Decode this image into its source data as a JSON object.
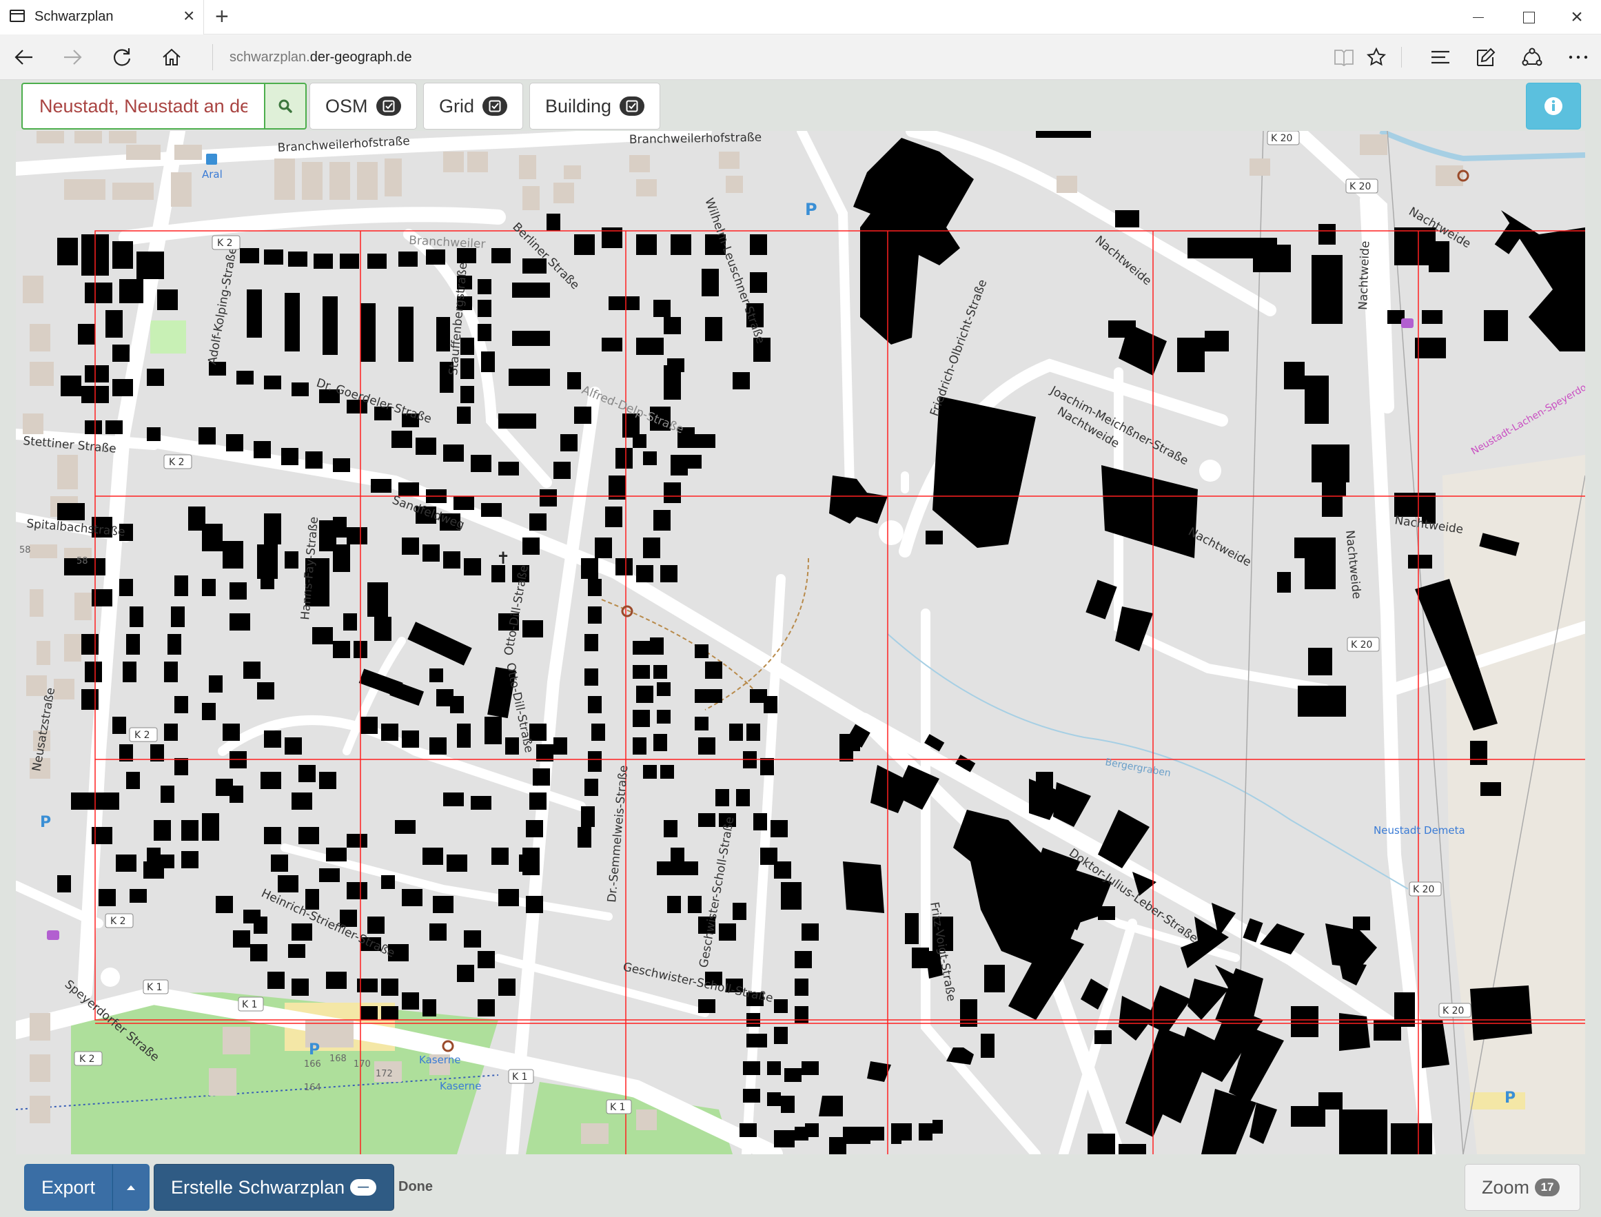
{
  "browser": {
    "tab_title": "Schwarzplan",
    "url_prefix": "schwarzplan.",
    "url_host": "der-geograph.de"
  },
  "toolbar": {
    "search_value": "Neustadt, Neustadt an der Weinstraße",
    "search_icon": "search-icon",
    "layers": [
      {
        "label": "OSM",
        "checked": true
      },
      {
        "label": "Grid",
        "checked": true
      },
      {
        "label": "Building",
        "checked": true
      }
    ],
    "info_icon": "info-circle-icon"
  },
  "map": {
    "street_labels": [
      "Branchweilerhofstraße",
      "Branchweilerhofstraße",
      "Branchweiler",
      "Berliner Straße",
      "Wilhelm-Leuschner-Straße",
      "Adolf-Kolping-Straße",
      "Stauffenbergstraße",
      "Dr. Goerdeler-Straße",
      "Alfred-Delp-Straße",
      "Stettiner Straße",
      "Sandfeldweg",
      "Spitalbachstraße",
      "Hanns-Fay-Straße",
      "Otto-Dill-Straße",
      "Otto-Dill-Straße",
      "Dr.-Semmelweis-Straße",
      "Heinrich-Strieffler-Straße",
      "Speyerdorfer Straße",
      "Neusatzstraße",
      "Geschwister-Scholl-Straße",
      "Geschwister-Scholl-Straße",
      "Friedrich-Olbricht-Straße",
      "Joachim-Meichßner-Straße",
      "Nachtweide",
      "Nachtweide",
      "Nachtweide",
      "Nachtweide",
      "Doktor-Julius-Leber-Straße",
      "Fritz-Voigt-Straße",
      "Nachtweide",
      "Nachtweide",
      "Neustadt-Lachen-Speyerdorf",
      "Spitalbachstraße"
    ],
    "road_refs": [
      "K 2",
      "K 20",
      "K 1"
    ],
    "poi_labels": [
      "Aral",
      "Kaserne",
      "Kaserne",
      "Neustadt Demeta"
    ],
    "house_numbers": [
      "166",
      "168",
      "170",
      "172",
      "164",
      "58",
      "58"
    ],
    "stream_label": "Bergergraben"
  },
  "bottom": {
    "export_label": "Export",
    "generate_label": "Erstelle Schwarzplan",
    "status": "Done",
    "zoom_label": "Zoom",
    "zoom_level": "17"
  },
  "colors": {
    "grid": "#ff2020",
    "building": "#000000",
    "search_border": "#4cae4c",
    "search_text": "#a94442",
    "info_button": "#5bc0de",
    "primary_button": "#3a6ea5"
  }
}
